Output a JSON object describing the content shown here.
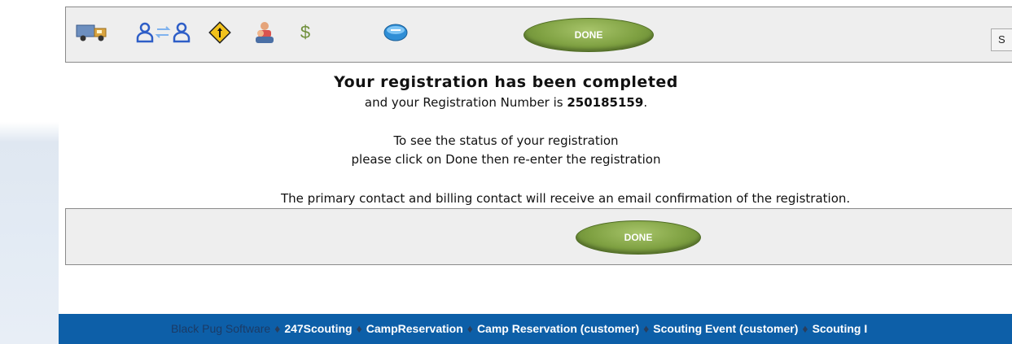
{
  "toolbar": {
    "icons": [
      "truck-icon",
      "transfer-users-icon",
      "road-sign-icon",
      "people-icon",
      "dollar-icon",
      "chat-bubble-icon"
    ],
    "dollar_glyph": "$",
    "done_label": "DONE",
    "side_button_label": "S"
  },
  "message": {
    "title": "Your registration has been completed",
    "reg_prefix": "and your Registration Number is ",
    "reg_number": "250185159",
    "reg_suffix": ".",
    "status_line1": "To see the status of your registration",
    "status_line2": "please click on Done then re-enter the registration",
    "email_notice": "The primary contact and billing contact will receive an email confirmation of the registration."
  },
  "bottom": {
    "done_label": "DONE"
  },
  "footer": {
    "brand": "Black Pug Software",
    "links": [
      "247Scouting",
      "CampReservation",
      "Camp Reservation (customer)",
      "Scouting Event (customer)",
      "Scouting I"
    ],
    "separator": "♦"
  },
  "colors": {
    "footer_bg": "#0d5fa8",
    "done_green": "#7fa142",
    "panel_bg": "#eeeeee"
  }
}
